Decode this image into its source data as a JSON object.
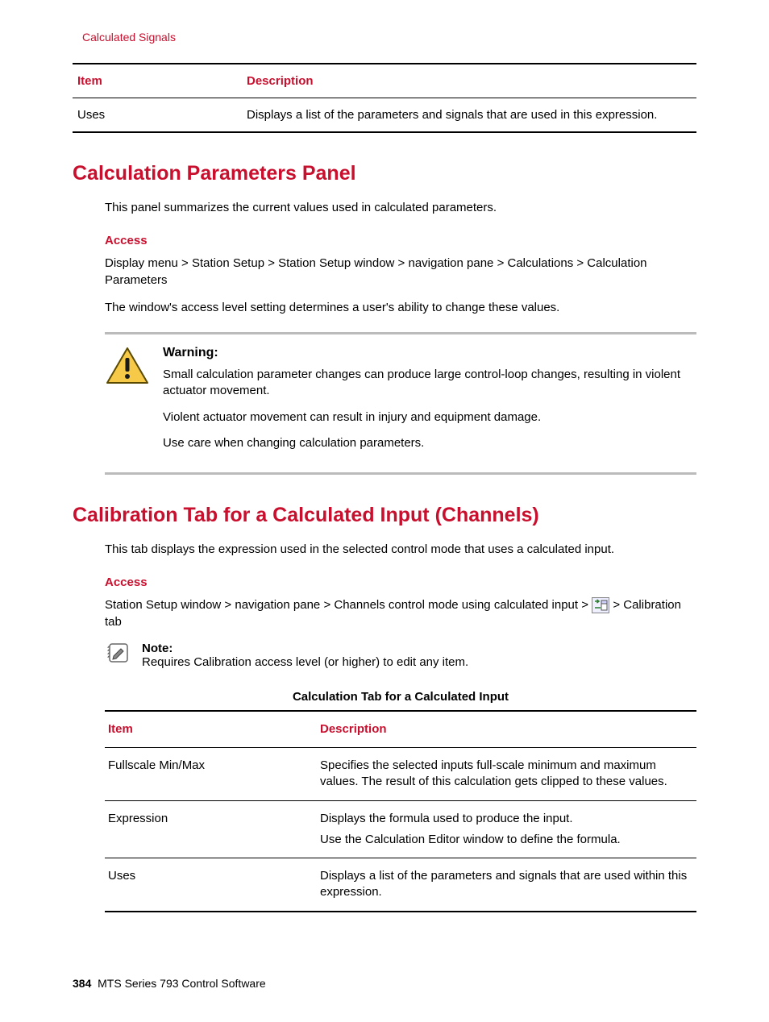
{
  "headerLink": "Calculated Signals",
  "table1": {
    "headers": {
      "c1": "Item",
      "c2": "Description"
    },
    "row": {
      "c1": "Uses",
      "c2": "Displays a list of the parameters and signals that are used in this expression."
    }
  },
  "section1": {
    "title": "Calculation Parameters Panel",
    "intro": "This panel summarizes the current values used in calculated parameters.",
    "accessHeading": "Access",
    "accessPath": "Display menu > Station Setup > Station Setup window > navigation pane > Calculations > Calculation Parameters",
    "accessNote": "The window's access level setting determines a user's ability to change these values.",
    "warning": {
      "title": "Warning:",
      "p1": "Small calculation parameter changes can produce large control-loop changes, resulting in violent actuator movement.",
      "p2": "Violent actuator movement can result in injury and equipment damage.",
      "p3": "Use care when changing calculation parameters."
    }
  },
  "section2": {
    "title": "Calibration Tab for a Calculated Input (Channels)",
    "intro": "This tab displays the expression used in the selected control mode that uses a calculated input.",
    "accessHeading": "Access",
    "accessPrefix": "Station Setup window > navigation pane > Channels control mode using calculated input > ",
    "accessSuffix": "> Calibration tab",
    "note": {
      "title": "Note:",
      "text": "Requires Calibration access level (or higher) to edit any item."
    },
    "tableTitle": "Calculation Tab for a Calculated Input",
    "table": {
      "headers": {
        "c1": "Item",
        "c2": "Description"
      },
      "rows": [
        {
          "c1": "Fullscale Min/Max",
          "c2": "Specifies the selected inputs full-scale minimum and maximum values. The result of this calculation gets clipped to these values."
        },
        {
          "c1": "Expression",
          "c2a": "Displays the formula used to produce the input.",
          "c2b": "Use the Calculation Editor window to define the formula."
        },
        {
          "c1": "Uses",
          "c2": "Displays a list of the parameters and signals that are used within this expression."
        }
      ]
    }
  },
  "footer": {
    "pageNum": "384",
    "title": "MTS Series 793 Control Software"
  }
}
